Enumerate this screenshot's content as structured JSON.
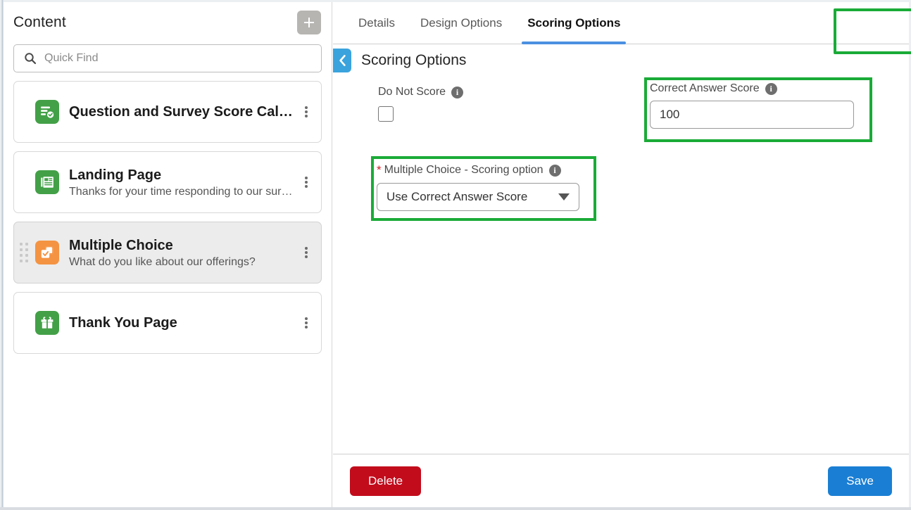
{
  "sidebar": {
    "title": "Content",
    "add_button_label": "+",
    "add_icon": "plus-icon",
    "search": {
      "placeholder": "Quick Find",
      "value": "",
      "icon": "search-icon"
    },
    "items": [
      {
        "title": "Question and Survey Score Calc...",
        "subtitle": "",
        "icon": "survey-score-icon",
        "icon_color": "#43a047",
        "selected": false,
        "draggable": false,
        "menu_icon": "kebab-menu-icon"
      },
      {
        "title": "Landing Page",
        "subtitle": "Thanks for your time responding to our surv...",
        "icon": "landing-page-icon",
        "icon_color": "#43a047",
        "selected": false,
        "draggable": false,
        "menu_icon": "kebab-menu-icon"
      },
      {
        "title": "Multiple Choice",
        "subtitle": "What do you like about our offerings?",
        "icon": "multiple-choice-icon",
        "icon_color": "#f49342",
        "selected": true,
        "draggable": true,
        "menu_icon": "kebab-menu-icon"
      },
      {
        "title": "Thank You Page",
        "subtitle": "",
        "icon": "gift-icon",
        "icon_color": "#43a047",
        "selected": false,
        "draggable": false,
        "menu_icon": "kebab-menu-icon"
      }
    ]
  },
  "panel": {
    "tabs": [
      {
        "label": "Details",
        "active": false
      },
      {
        "label": "Design Options",
        "active": false
      },
      {
        "label": "Scoring Options",
        "active": true
      }
    ],
    "back_icon": "chevron-left-icon",
    "heading": "Scoring Options",
    "fields": {
      "do_not_score": {
        "label": "Do Not Score",
        "info_icon": "info-icon",
        "checked": false
      },
      "correct_answer_score": {
        "label": "Correct Answer Score",
        "info_icon": "info-icon",
        "value": "100",
        "placeholder": ""
      },
      "scoring_option": {
        "required_marker": "*",
        "label": "Multiple Choice - Scoring option",
        "info_icon": "info-icon",
        "selected": "Use Correct Answer Score",
        "caret_icon": "chevron-down-icon"
      }
    },
    "footer": {
      "delete_label": "Delete",
      "save_label": "Save"
    }
  },
  "highlights": {
    "color": "#1aab37",
    "regions": [
      "scoring-options-tab",
      "correct-answer-score-field",
      "scoring-option-field"
    ]
  },
  "colors": {
    "accent_blue": "#4a90e2",
    "save_blue": "#1a7fd4",
    "delete_red": "#c20c1c",
    "highlight_green": "#1aab37",
    "icon_green": "#43a047",
    "icon_orange": "#f49342"
  }
}
